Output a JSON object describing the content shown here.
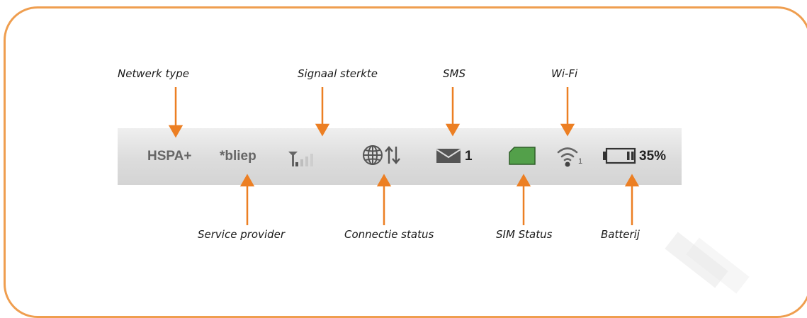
{
  "colors": {
    "frame": "#ef9e4f",
    "arrow": "#ec7f23",
    "statusbar": "#dcdcdc",
    "status_text": "#666666",
    "sim_green": "#53a04a"
  },
  "labels": {
    "network_type": "Netwerk type",
    "signal_strength": "Signaal sterkte",
    "sms": "SMS",
    "wifi": "Wi-Fi",
    "service_provider": "Service provider",
    "connection_status": "Connectie status",
    "sim_status": "SIM Status",
    "battery": "Batterij"
  },
  "statusbar": {
    "network_type": "HSPA+",
    "provider": "*bliep",
    "signal_level": 1,
    "signal_max": 5,
    "sms_count": "1",
    "wifi_clients": "1",
    "battery_percent": "35%",
    "battery_level": 0.35,
    "icons": [
      "signal-icon",
      "globe-icon",
      "up-down-arrows-icon",
      "envelope-icon",
      "sim-card-icon",
      "wifi-icon",
      "battery-icon"
    ]
  }
}
